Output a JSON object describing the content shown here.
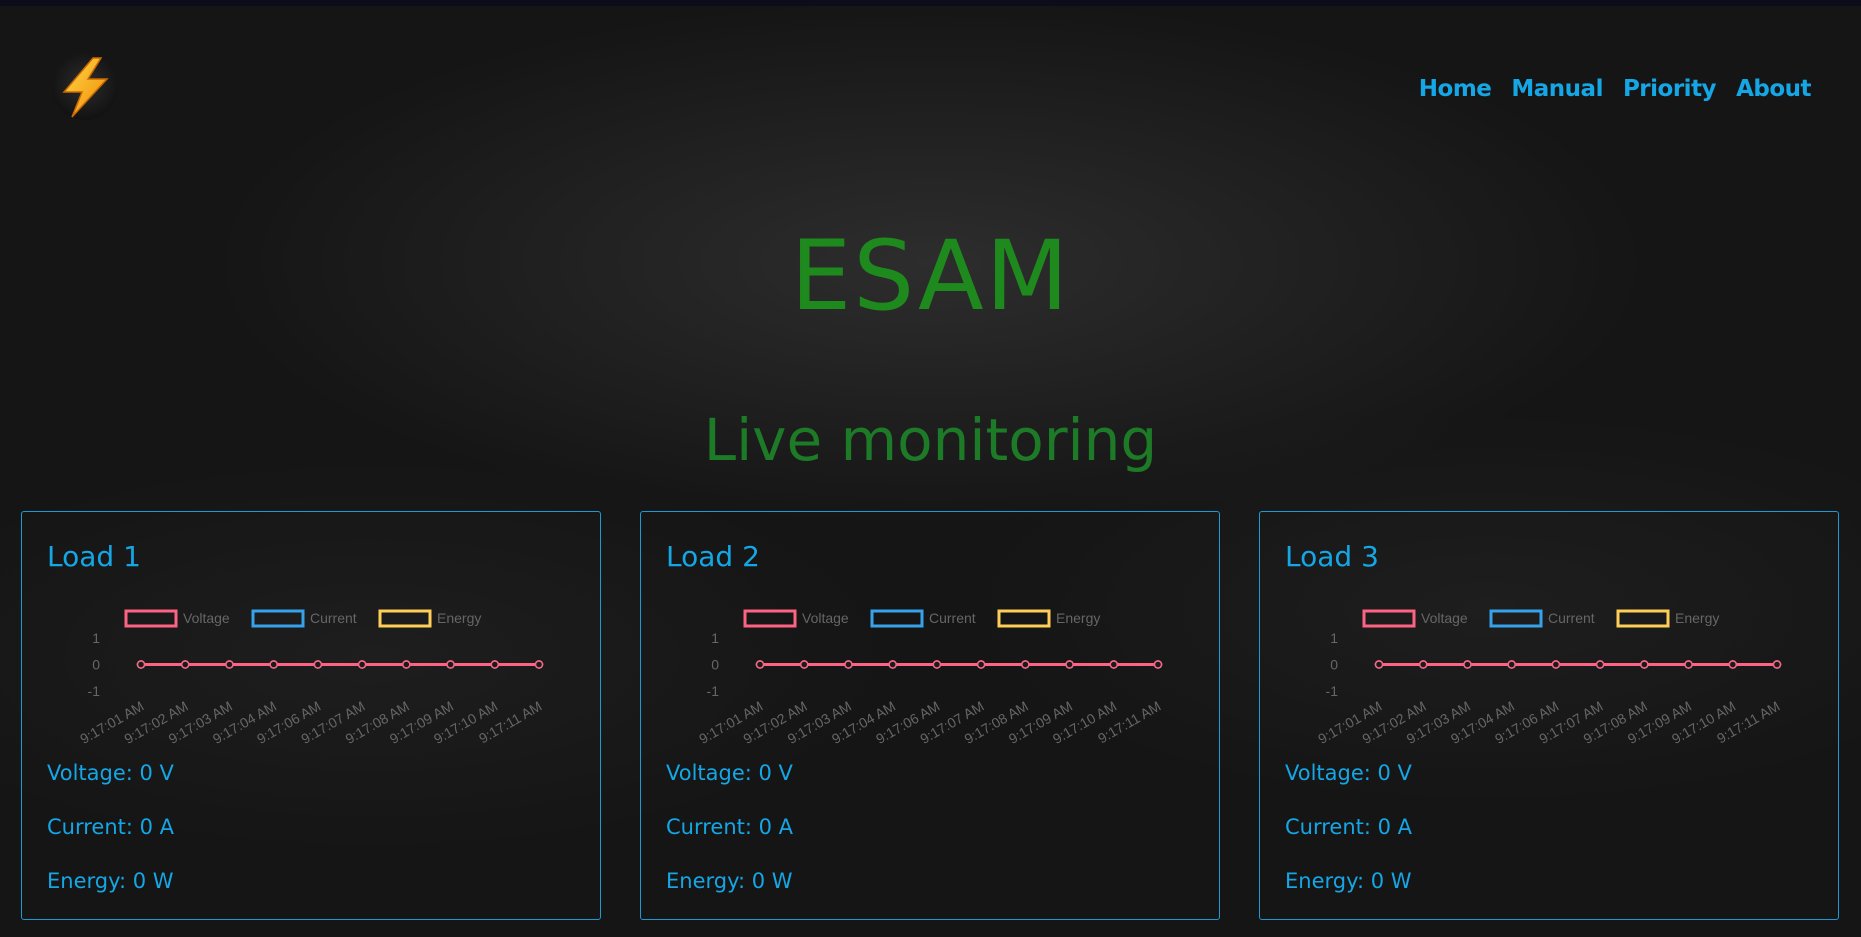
{
  "app": {
    "title": "ESAM",
    "subtitle": "Live monitoring"
  },
  "nav": {
    "items": [
      "Home",
      "Manual",
      "Priority",
      "About"
    ]
  },
  "logo": {
    "icon": "lightning-bolt-icon"
  },
  "colors": {
    "accent": "#15a6e6",
    "title_green": "#1e8a1e",
    "voltage": "#ff6384",
    "current": "#36a2eb",
    "energy": "#ffce56"
  },
  "loads": [
    {
      "title": "Load 1",
      "voltage_text": "Voltage: 0 V",
      "current_text": "Current: 0 A",
      "energy_text": "Energy: 0 W"
    },
    {
      "title": "Load 2",
      "voltage_text": "Voltage: 0 V",
      "current_text": "Current: 0 A",
      "energy_text": "Energy: 0 W"
    },
    {
      "title": "Load 3",
      "voltage_text": "Voltage: 0 V",
      "current_text": "Current: 0 A",
      "energy_text": "Energy: 0 W"
    }
  ],
  "chart_data": [
    {
      "type": "line",
      "x": [
        "9:17:01 AM",
        "9:17:02 AM",
        "9:17:03 AM",
        "9:17:04 AM",
        "9:17:06 AM",
        "9:17:07 AM",
        "9:17:08 AM",
        "9:17:09 AM",
        "9:17:10 AM",
        "9:17:11 AM"
      ],
      "series": [
        {
          "name": "Voltage",
          "values": [
            0,
            0,
            0,
            0,
            0,
            0,
            0,
            0,
            0,
            0
          ]
        },
        {
          "name": "Current",
          "values": [
            0,
            0,
            0,
            0,
            0,
            0,
            0,
            0,
            0,
            0
          ]
        },
        {
          "name": "Energy",
          "values": [
            0,
            0,
            0,
            0,
            0,
            0,
            0,
            0,
            0,
            0
          ]
        }
      ],
      "yticks": [
        1,
        0,
        -1
      ],
      "ylim": [
        -1,
        1
      ],
      "legend": "top",
      "grid": false
    },
    {
      "type": "line",
      "x": [
        "9:17:01 AM",
        "9:17:02 AM",
        "9:17:03 AM",
        "9:17:04 AM",
        "9:17:06 AM",
        "9:17:07 AM",
        "9:17:08 AM",
        "9:17:09 AM",
        "9:17:10 AM",
        "9:17:11 AM"
      ],
      "series": [
        {
          "name": "Voltage",
          "values": [
            0,
            0,
            0,
            0,
            0,
            0,
            0,
            0,
            0,
            0
          ]
        },
        {
          "name": "Current",
          "values": [
            0,
            0,
            0,
            0,
            0,
            0,
            0,
            0,
            0,
            0
          ]
        },
        {
          "name": "Energy",
          "values": [
            0,
            0,
            0,
            0,
            0,
            0,
            0,
            0,
            0,
            0
          ]
        }
      ],
      "yticks": [
        1,
        0,
        -1
      ],
      "ylim": [
        -1,
        1
      ],
      "legend": "top",
      "grid": false
    },
    {
      "type": "line",
      "x": [
        "9:17:01 AM",
        "9:17:02 AM",
        "9:17:03 AM",
        "9:17:04 AM",
        "9:17:06 AM",
        "9:17:07 AM",
        "9:17:08 AM",
        "9:17:09 AM",
        "9:17:10 AM",
        "9:17:11 AM"
      ],
      "series": [
        {
          "name": "Voltage",
          "values": [
            0,
            0,
            0,
            0,
            0,
            0,
            0,
            0,
            0,
            0
          ]
        },
        {
          "name": "Current",
          "values": [
            0,
            0,
            0,
            0,
            0,
            0,
            0,
            0,
            0,
            0
          ]
        },
        {
          "name": "Energy",
          "values": [
            0,
            0,
            0,
            0,
            0,
            0,
            0,
            0,
            0,
            0
          ]
        }
      ],
      "yticks": [
        1,
        0,
        -1
      ],
      "ylim": [
        -1,
        1
      ],
      "legend": "top",
      "grid": false
    }
  ]
}
